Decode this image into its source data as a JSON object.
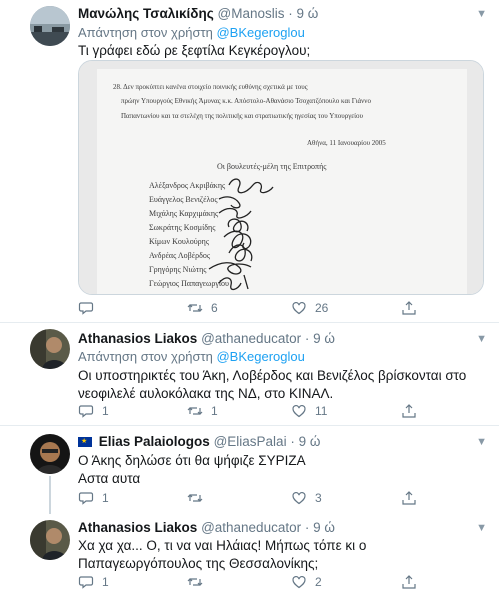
{
  "tweets": [
    {
      "name": "Μανώλης Τσαλικίδης",
      "handle": "@Manoslis",
      "time": "9 ώ",
      "reply_prefix": "Απάντηση στον χρήστη",
      "reply_mention": "@BKegeroglou",
      "text": "Τι γράφει εδώ ρε ξεφτίλα Κεγκέρογλου;",
      "replies": "",
      "retweets": "6",
      "likes": "26"
    },
    {
      "name": "Athanasios Liakos",
      "handle": "@athaneducator",
      "time": "9 ώ",
      "reply_prefix": "Απάντηση στον χρήστη",
      "reply_mention": "@BKegeroglou",
      "text": "Οι υποστηρικτές του Άκη, Λοβέρδος και Βενιζέλος βρίσκονται στο νεοφιλελέ αυλοκόλακα της ΝΔ, στο ΚΙΝΑΛ.",
      "replies": "1",
      "retweets": "1",
      "likes": "11"
    },
    {
      "name": "Elias Palaiologos",
      "handle": "@EliasPalai",
      "time": "9 ώ",
      "text_line1": "Ο Άκης δηλώσε ότι θα ψήφιζε ΣΥΡΙΖΑ",
      "text_line2": "Αστα αυτα",
      "replies": "1",
      "retweets": "",
      "likes": "3"
    },
    {
      "name": "Athanasios Liakos",
      "handle": "@athaneducator",
      "time": "9 ώ",
      "text": "Χα χα χα... Ο, τι να ναι Ηλάιας! Μήπως τόπε κι ο Παπαγεωργόπουλος της Θεσσαλονίκης;",
      "replies": "1",
      "retweets": "",
      "likes": "2"
    }
  ],
  "document": {
    "para_line1": "28. Δεν προκύπτει κανένα στοιχείο ποινικής ευθύνης σχετικά με τους",
    "para_line2": "πρώην Υπουργούς Εθνικής Άμυνας κ.κ. Απόστολο-Αθανάσιο Τσοχατζόπουλο και Γιάννο",
    "para_line3": "Παπαντωνίου και τα στελέχη της πολιτικής και στρατιωτικής ηγεσίας του Υπουργείου",
    "date": "Αθήνα, 11 Ιανουαρίου 2005",
    "heading": "Οι βουλευτές-μέλη της Επιτροπής",
    "members": [
      "Αλέξανδρος Ακριβάκης",
      "Ευάγγελος Βενιζέλος",
      "Μιχάλης Καρχιμάκης",
      "Σωκράτης Κοσμίδης",
      "Κίμων Κουλούρης",
      "Ανδρέας Λοβέρδος",
      "Γρηγόρης Νιώτης",
      "Γεώργιος Παπαγεωργίου"
    ]
  },
  "colors": {
    "link": "#1da1f2",
    "muted": "#657786",
    "eu_flag": "#003399"
  }
}
